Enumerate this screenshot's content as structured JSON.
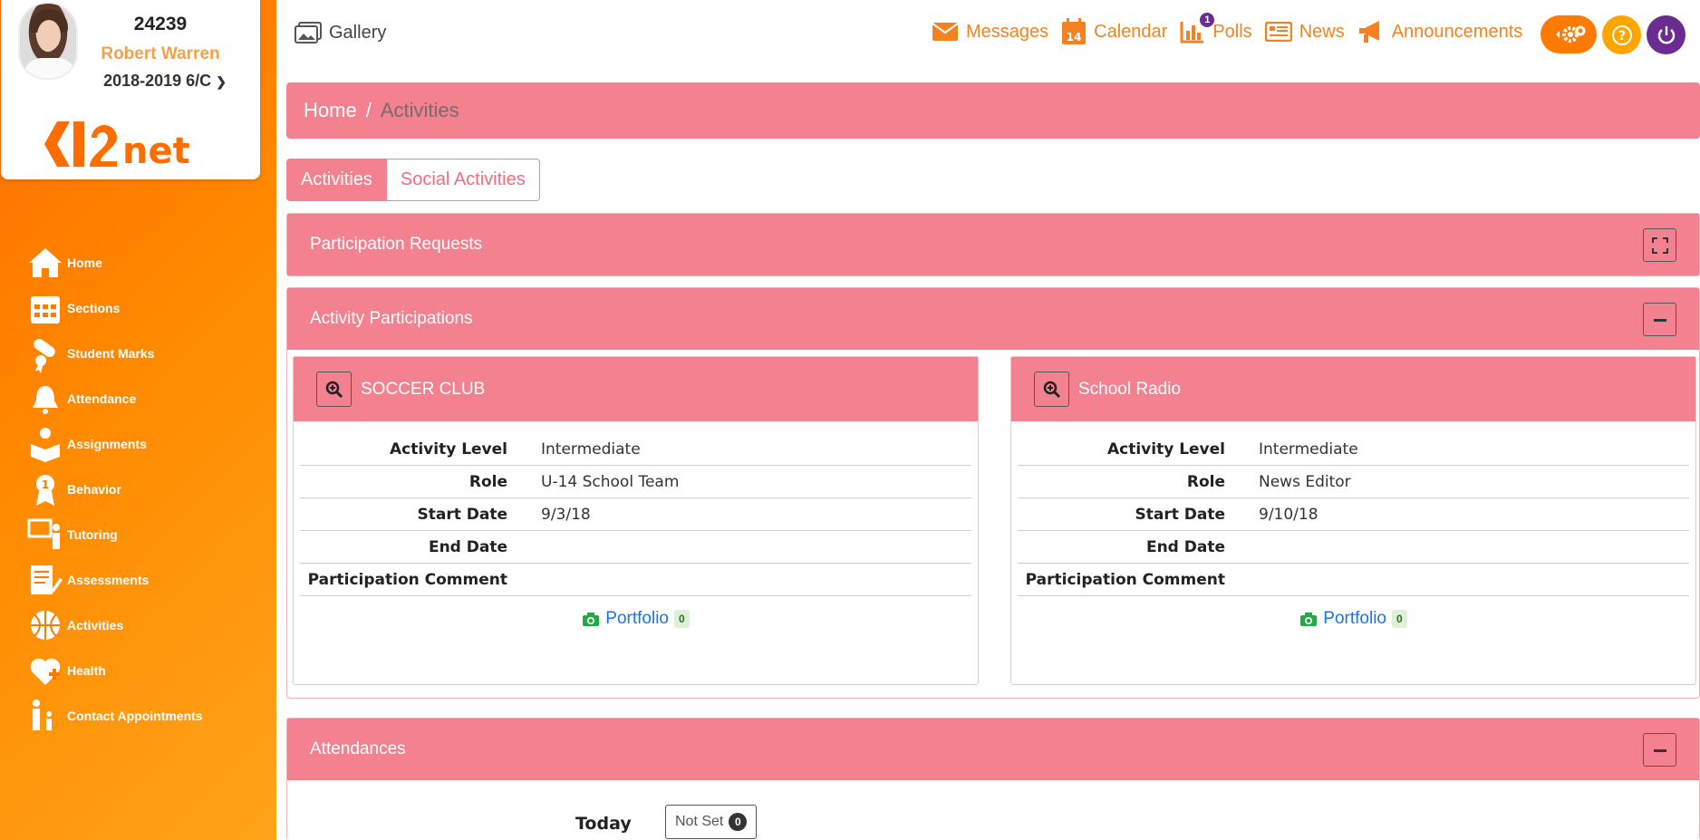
{
  "profile": {
    "student_id": "24239",
    "name": "Robert Warren",
    "year": "2018-2019 6/C",
    "logo_text": "K12net"
  },
  "sidebar": {
    "items": [
      {
        "label": "Home",
        "icon": "home-icon"
      },
      {
        "label": "Sections",
        "icon": "calendar-grid-icon"
      },
      {
        "label": "Student Marks",
        "icon": "diploma-icon"
      },
      {
        "label": "Attendance",
        "icon": "bell-icon"
      },
      {
        "label": "Assignments",
        "icon": "reading-student-icon"
      },
      {
        "label": "Behavior",
        "icon": "medal-icon"
      },
      {
        "label": "Tutoring",
        "icon": "teacher-board-icon"
      },
      {
        "label": "Assessments",
        "icon": "document-pen-icon"
      },
      {
        "label": "Activities",
        "icon": "basketball-icon"
      },
      {
        "label": "Health",
        "icon": "heart-plus-icon"
      },
      {
        "label": "Contact Appointments",
        "icon": "family-icon"
      }
    ]
  },
  "topbar": {
    "gallery": "Gallery",
    "messages": "Messages",
    "calendar": "Calendar",
    "calendar_day": "14",
    "polls": "Polls",
    "polls_badge": "1",
    "news": "News",
    "announcements": "Announcements"
  },
  "breadcrumb": {
    "home": "Home",
    "separator": "/",
    "current": "Activities"
  },
  "tabs": {
    "activities": "Activities",
    "social": "Social Activities"
  },
  "panels": {
    "requests": "Participation Requests",
    "participations": "Activity Participations",
    "attendances": "Attendances"
  },
  "cards": [
    {
      "title": "SOCCER CLUB",
      "rows": [
        {
          "label": "Activity Level",
          "value": "Intermediate"
        },
        {
          "label": "Role",
          "value": "U-14 School Team"
        },
        {
          "label": "Start Date",
          "value": "9/3/18"
        },
        {
          "label": "End Date",
          "value": ""
        },
        {
          "label": "Participation Comment",
          "value": ""
        }
      ],
      "portfolio": "Portfolio",
      "portfolio_count": "0"
    },
    {
      "title": "School Radio",
      "rows": [
        {
          "label": "Activity Level",
          "value": "Intermediate"
        },
        {
          "label": "Role",
          "value": "News Editor"
        },
        {
          "label": "Start Date",
          "value": "9/10/18"
        },
        {
          "label": "End Date",
          "value": ""
        },
        {
          "label": "Participation Comment",
          "value": ""
        }
      ],
      "portfolio": "Portfolio",
      "portfolio_count": "0"
    }
  ],
  "attendance": {
    "today_label": "Today",
    "status": "Not Set",
    "count": "0"
  },
  "colors": {
    "sidebar_orange": "#ff7a00",
    "panel_pink": "#f3818f",
    "topnav_orange": "#f58220",
    "power_purple": "#6a2c91",
    "help_yellow": "#ffa500"
  }
}
